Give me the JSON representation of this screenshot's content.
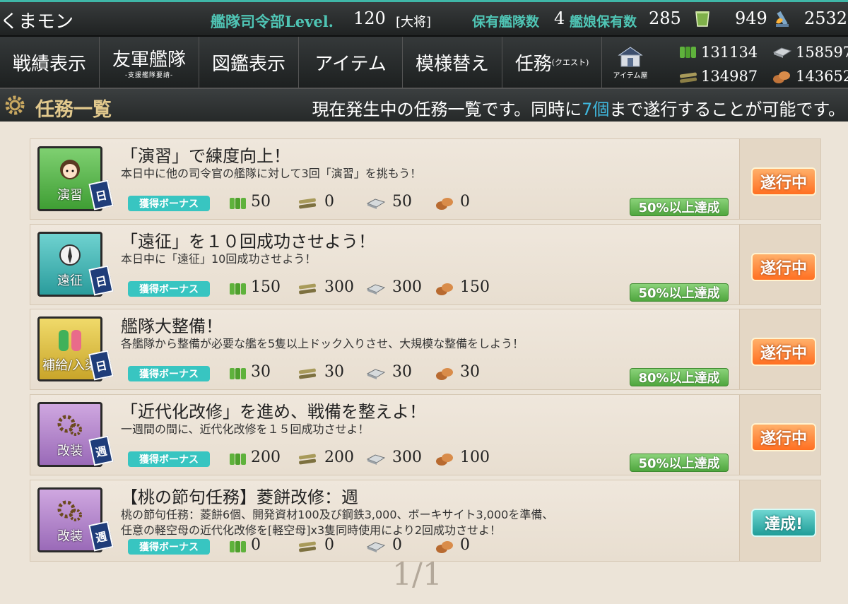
{
  "top": {
    "nickname": "くまモン",
    "admiral_label": "艦隊司令部Level.",
    "admiral_level": "120",
    "admiral_rank": "[大将]",
    "fleet_label": "保有艦隊数",
    "fleet_count": "4",
    "shipgirl_label": "艦娘保有数",
    "shipgirl_count": "285",
    "bucket_count": "949",
    "burner_count": "2532"
  },
  "nav": {
    "items": [
      {
        "label": "戦績表示"
      },
      {
        "label": "友軍艦隊",
        "sub": "-支援艦隊要請-"
      },
      {
        "label": "図鑑表示"
      },
      {
        "label": "アイテム"
      },
      {
        "label": "模様替え"
      },
      {
        "label": "任務",
        "sub": "(クエスト)"
      }
    ],
    "shop_label": "アイテム屋"
  },
  "resources": {
    "fuel": "131134",
    "steel": "158597",
    "ammo": "134987",
    "bauxite": "143652"
  },
  "title": {
    "text": "任務一覧",
    "info_pre": "現在発生中の任務一覧です。同時に",
    "info_num": "7個",
    "info_post": "まで遂行することが可能です。"
  },
  "bonus_label": "獲得ボーナス",
  "quests": [
    {
      "category": "演習",
      "period": "日",
      "title": "「演習」で練度向上！",
      "desc": [
        "本日中に他の司令官の艦隊に対して3回「演習」を挑もう！"
      ],
      "fuel": "50",
      "ammo": "0",
      "steel": "50",
      "bauxite": "0",
      "progress": "50%以上達成",
      "status": "遂行中"
    },
    {
      "category": "遠征",
      "period": "日",
      "title": "「遠征」を１０回成功させよう！",
      "desc": [
        "本日中に「遠征」10回成功させよう！"
      ],
      "fuel": "150",
      "ammo": "300",
      "steel": "300",
      "bauxite": "150",
      "progress": "50%以上達成",
      "status": "遂行中"
    },
    {
      "category": "補給/入渠",
      "period": "日",
      "title": "艦隊大整備！",
      "desc": [
        "各艦隊から整備が必要な艦を5隻以上ドック入りさせ、大規模な整備をしよう！"
      ],
      "fuel": "30",
      "ammo": "30",
      "steel": "30",
      "bauxite": "30",
      "progress": "80%以上達成",
      "status": "遂行中"
    },
    {
      "category": "改装",
      "period": "週",
      "title": "「近代化改修」を進め、戦備を整えよ！",
      "desc": [
        "一週間の間に、近代化改修を１５回成功させよ！"
      ],
      "fuel": "200",
      "ammo": "200",
      "steel": "300",
      "bauxite": "100",
      "progress": "50%以上達成",
      "status": "遂行中"
    },
    {
      "category": "改装",
      "period": "週",
      "title": "【桃の節句任務】菱餅改修：週",
      "desc": [
        "桃の節句任務：菱餅6個、開発資材100及び鋼鉄3,000、ボーキサイト3,000を準備、",
        "任意の軽空母の近代化改修を[軽空母]x3隻同時使用により2回成功させよ！"
      ],
      "fuel": "0",
      "ammo": "0",
      "steel": "0",
      "bauxite": "0",
      "progress": "",
      "status": "達成!"
    }
  ],
  "pager": "1/1",
  "colors": {
    "teal_accent": "#4fc4b4",
    "exercise_cat": "#4caf50",
    "expedition_cat": "#3aa8a8",
    "supply_cat": "#d8b938",
    "modernize_cat": "#b183c8",
    "in_progress": "#ff7a2a",
    "completed": "#2aa9a3"
  }
}
